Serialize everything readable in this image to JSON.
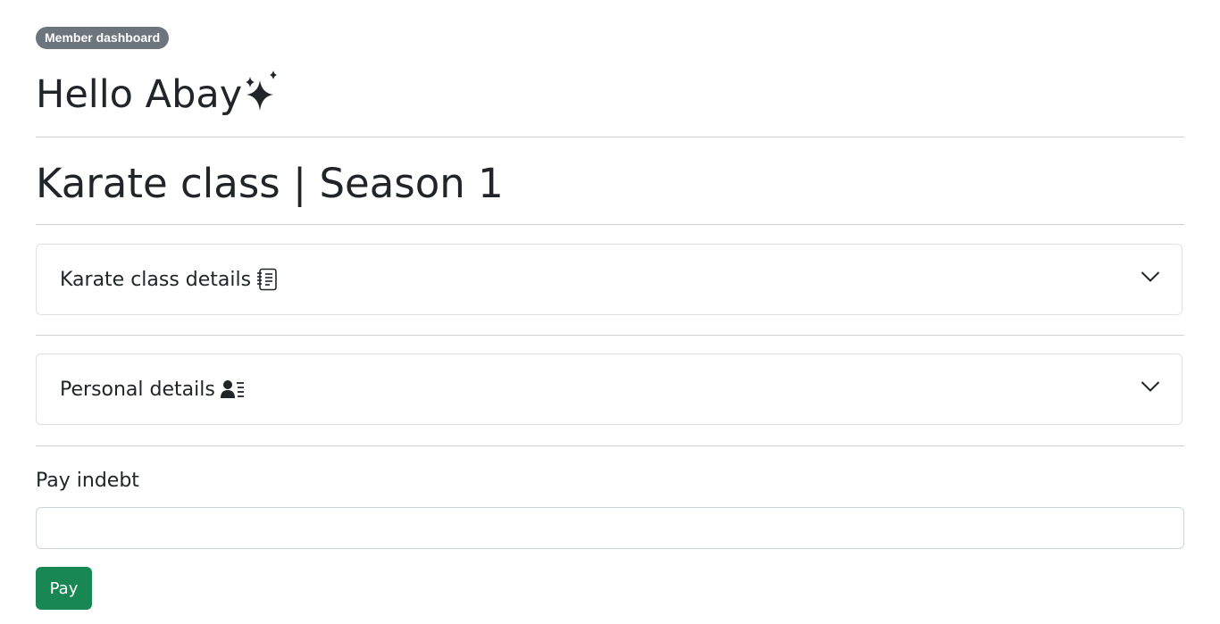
{
  "header": {
    "badge": "Member dashboard",
    "greeting": "Hello Abay",
    "greeting_icon": "sparkles-icon"
  },
  "class_info": {
    "title": "Karate class | Season 1"
  },
  "accordions": [
    {
      "title": "Karate class details",
      "icon": "journal-text-icon",
      "expanded": false
    },
    {
      "title": "Personal details",
      "icon": "person-lines-icon",
      "expanded": false
    }
  ],
  "payment": {
    "label": "Pay indebt",
    "value": "",
    "button_label": "Pay"
  },
  "colors": {
    "badge_bg": "#6c757d",
    "pay_button_bg": "#198754",
    "text": "#212529"
  }
}
